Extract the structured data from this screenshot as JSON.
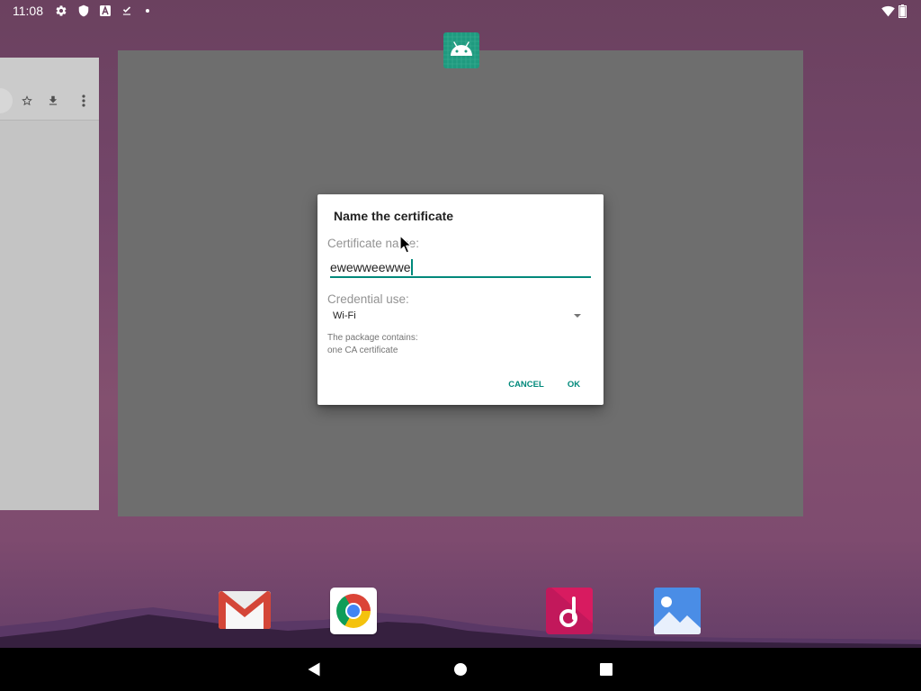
{
  "status_bar": {
    "time": "11:08",
    "left_icons": [
      "gear-icon",
      "shield-icon",
      "a-box-icon",
      "download-done-icon",
      "notification-dot-icon"
    ],
    "right_icons": [
      "wifi-icon",
      "battery-icon"
    ],
    "battery_level": 1.0
  },
  "background_window": {
    "toolbar_icons": [
      "star-icon",
      "download-icon",
      "more-vert-icon"
    ]
  },
  "main_window": {
    "app_icon": "android-icon"
  },
  "dialog": {
    "title": "Name the certificate",
    "name_label": "Certificate name:",
    "name_value": "ewewweewwe",
    "use_label": "Credential use:",
    "use_selected": "Wi-Fi",
    "package_info": [
      "The package contains:",
      "one CA certificate"
    ],
    "buttons": {
      "cancel": "CANCEL",
      "ok": "OK"
    }
  },
  "cursor": {
    "icon": "mouse-pointer-icon"
  },
  "dock": {
    "apps": [
      {
        "icon": "gmail-icon"
      },
      {
        "icon": "chrome-icon"
      },
      {
        "icon": "music-app-icon"
      },
      {
        "icon": "gallery-icon"
      }
    ]
  },
  "nav_bar": {
    "buttons": [
      "back-icon",
      "home-icon",
      "recents-icon"
    ]
  },
  "colors": {
    "accent": "#00897b",
    "dialog_background": "#ffffff",
    "window_scrim": "#6e6e6e",
    "nav_bar": "#000000",
    "wallpaper_top": "#6b415f",
    "wallpaper_bottom": "#5c3a66"
  }
}
